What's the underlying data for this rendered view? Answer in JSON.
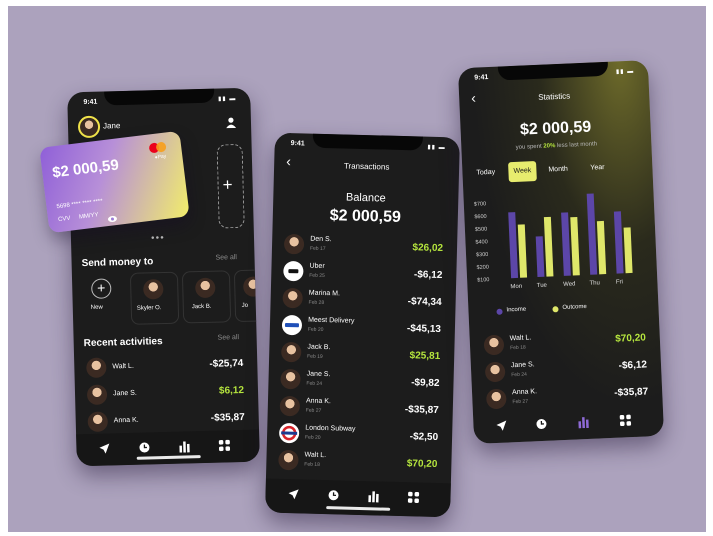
{
  "wallet": {
    "status_time": "9:41",
    "user_name": "Jane",
    "card": {
      "balance": "$2 000,59",
      "pay_label": "Pay",
      "number": "5698 **** **** ****",
      "cvv_label": "CVV",
      "expiry_label": "MM/YY",
      "brand_colors": [
        "#eb001b",
        "#f79e1b"
      ]
    },
    "send_money_title": "Send money to",
    "see_all": "See all",
    "contacts": [
      {
        "name": "New"
      },
      {
        "name": "Skyler O."
      },
      {
        "name": "Jack B."
      },
      {
        "name": "Jo"
      }
    ],
    "recent_title": "Recent activities",
    "recent_see_all": "See all",
    "activities": [
      {
        "name": "Walt L.",
        "amount": "-$25,74",
        "positive": false
      },
      {
        "name": "Jane S.",
        "amount": "$6,12",
        "positive": true
      },
      {
        "name": "Anna K.",
        "amount": "-$35,87",
        "positive": false
      }
    ]
  },
  "transactions": {
    "status_time": "9:41",
    "title": "Transactions",
    "balance_label": "Balance",
    "balance": "$2 000,59",
    "items": [
      {
        "name": "Den S.",
        "date": "Feb 17",
        "amount": "$26,02",
        "positive": true,
        "icon": "person"
      },
      {
        "name": "Uber",
        "date": "Feb 25",
        "amount": "-$6,12",
        "positive": false,
        "icon": "uber-logo"
      },
      {
        "name": "Marina M.",
        "date": "Feb 28",
        "amount": "-$74,34",
        "positive": false,
        "icon": "person"
      },
      {
        "name": "Meest Delivery",
        "date": "Feb 20",
        "amount": "-$45,13",
        "positive": false,
        "icon": "meest-logo"
      },
      {
        "name": "Jack B.",
        "date": "Feb 19",
        "amount": "$25,81",
        "positive": true,
        "icon": "person"
      },
      {
        "name": "Jane S.",
        "date": "Feb 24",
        "amount": "-$9,82",
        "positive": false,
        "icon": "person"
      },
      {
        "name": "Anna K.",
        "date": "Feb 27",
        "amount": "-$35,87",
        "positive": false,
        "icon": "person"
      },
      {
        "name": "London Subway",
        "date": "Feb 20",
        "amount": "-$2,50",
        "positive": false,
        "icon": "subway-logo"
      },
      {
        "name": "Walt L.",
        "date": "Feb 18",
        "amount": "$70,20",
        "positive": true,
        "icon": "person"
      }
    ]
  },
  "statistics": {
    "status_time": "9:41",
    "title": "Statistics",
    "total": "$2 000,59",
    "subtitle_prefix": "you spent ",
    "subtitle_highlight": "20%",
    "subtitle_suffix": " less last month",
    "periods": [
      {
        "label": "Today",
        "active": false
      },
      {
        "label": "Week",
        "active": true
      },
      {
        "label": "Month",
        "active": false
      },
      {
        "label": "Year",
        "active": false
      }
    ],
    "legend_income": "Income",
    "legend_outcome": "Outcome",
    "recent": [
      {
        "name": "Walt L.",
        "date": "Feb 18",
        "amount": "$70,20",
        "positive": true
      },
      {
        "name": "Jane S.",
        "date": "Feb 24",
        "amount": "-$6,12",
        "positive": false
      },
      {
        "name": "Anna K.",
        "date": "Feb 27",
        "amount": "-$35,87",
        "positive": false
      }
    ]
  },
  "chart_data": {
    "type": "bar",
    "categories": [
      "Mon",
      "Tue",
      "Wed",
      "Thu",
      "Fri"
    ],
    "series": [
      {
        "name": "Income",
        "color": "#5c46a8",
        "values": [
          620,
          420,
          600,
          740,
          590
        ]
      },
      {
        "name": "Outcome",
        "color": "#dfe76a",
        "values": [
          520,
          570,
          560,
          520,
          460
        ]
      }
    ],
    "yticks": [
      "$700",
      "$600",
      "$500",
      "$400",
      "$300",
      "$200",
      "$100"
    ],
    "ylim": [
      100,
      700
    ],
    "legend": "bottom",
    "grid": false
  }
}
